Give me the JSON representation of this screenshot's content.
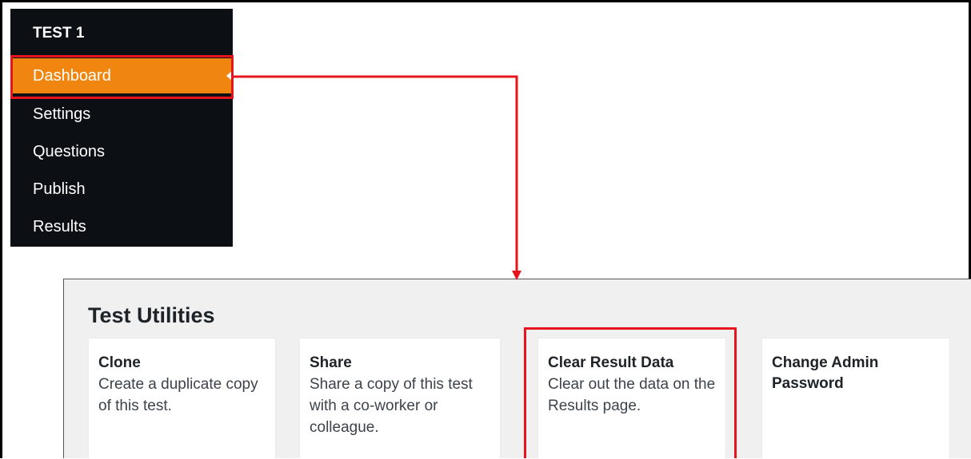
{
  "sidebar": {
    "title": "TEST 1",
    "items": [
      {
        "label": "Dashboard"
      },
      {
        "label": "Settings"
      },
      {
        "label": "Questions"
      },
      {
        "label": "Publish"
      },
      {
        "label": "Results"
      }
    ]
  },
  "panel": {
    "title": "Test Utilities",
    "cards": [
      {
        "title": "Clone",
        "description": "Create a duplicate copy of this test."
      },
      {
        "title": "Share",
        "description": "Share a copy of this test with a co-worker or colleague."
      },
      {
        "title": "Clear Result Data",
        "description": "Clear out the data on the Results page."
      },
      {
        "title": "Change Admin Password",
        "description": ""
      }
    ]
  },
  "colors": {
    "sidebar_bg": "#0c0f14",
    "active_bg": "#f0860f",
    "annotation_red": "#e8141d",
    "panel_bg": "#f0f0f1"
  }
}
